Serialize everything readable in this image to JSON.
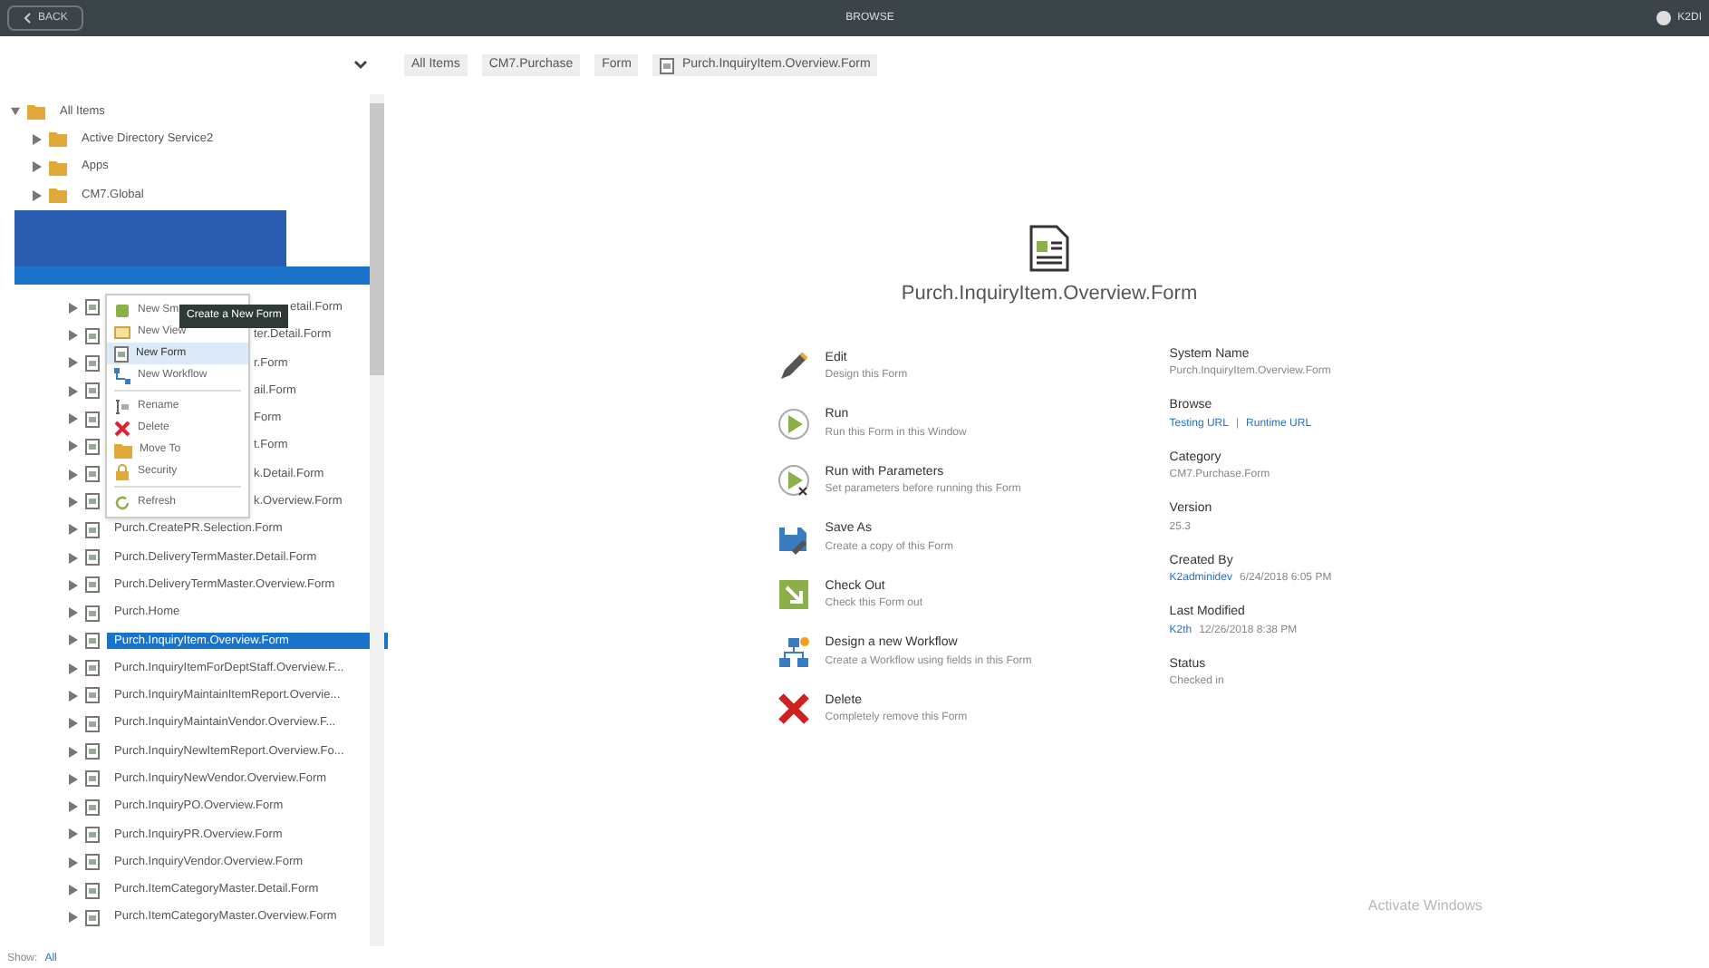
{
  "top_bar": {
    "back": "BACK",
    "title": "BROWSE",
    "user": "K2DI"
  },
  "breadcrumb": [
    "All Items",
    "CM7.Purchase",
    "Form",
    "Purch.InquiryItem.Overview.Form"
  ],
  "tree": {
    "root": {
      "label": "All Items",
      "expanded": true
    },
    "items": [
      {
        "kind": "folder",
        "label": "Active Directory Service2",
        "selected": false
      },
      {
        "kind": "folder",
        "label": "Apps",
        "selected": false
      },
      {
        "kind": "folder",
        "label": "CM7.Global",
        "selected": false
      },
      {
        "kind": "redacted"
      },
      {
        "kind": "partial_tip",
        "label": "etail.Form",
        "selected": false
      },
      {
        "kind": "partial",
        "label": "ter.Detail.Form",
        "selected": false
      },
      {
        "kind": "partial",
        "label": "r.Form",
        "selected": false
      },
      {
        "kind": "partial",
        "label": "ail.Form",
        "selected": false
      },
      {
        "kind": "partial",
        "label": "Form",
        "selected": false
      },
      {
        "kind": "partial",
        "label": "t.Form",
        "selected": false
      },
      {
        "kind": "partial",
        "label": "k.Detail.Form",
        "selected": false
      },
      {
        "kind": "partial",
        "label": "k.Overview.Form",
        "selected": false
      },
      {
        "kind": "form",
        "label": "Purch.CreatePR.Selection.Form",
        "selected": false
      },
      {
        "kind": "form",
        "label": "Purch.DeliveryTermMaster.Detail.Form",
        "selected": false
      },
      {
        "kind": "form",
        "label": "Purch.DeliveryTermMaster.Overview.Form",
        "selected": false
      },
      {
        "kind": "form",
        "label": "Purch.Home",
        "selected": false
      },
      {
        "kind": "form",
        "label": "Purch.InquiryItem.Overview.Form",
        "selected": true
      },
      {
        "kind": "form",
        "label": "Purch.InquiryItemForDeptStaff.Overview.F...",
        "selected": false
      },
      {
        "kind": "form",
        "label": "Purch.InquiryMaintainItemReport.Overvie...",
        "selected": false
      },
      {
        "kind": "form",
        "label": "Purch.InquiryMaintainVendor.Overview.F...",
        "selected": false
      },
      {
        "kind": "form",
        "label": "Purch.InquiryNewItemReport.Overview.Fo...",
        "selected": false
      },
      {
        "kind": "form",
        "label": "Purch.InquiryNewVendor.Overview.Form",
        "selected": false
      },
      {
        "kind": "form",
        "label": "Purch.InquiryPO.Overview.Form",
        "selected": false
      },
      {
        "kind": "form",
        "label": "Purch.InquiryPR.Overview.Form",
        "selected": false
      },
      {
        "kind": "form",
        "label": "Purch.InquiryVendor.Overview.Form",
        "selected": false
      },
      {
        "kind": "form",
        "label": "Purch.ItemCategoryMaster.Detail.Form",
        "selected": false
      },
      {
        "kind": "form",
        "label": "Purch.ItemCategoryMaster.Overview.Form",
        "selected": false
      }
    ]
  },
  "context_menu": [
    {
      "kind": "smartobject",
      "label": "New Sm",
      "selected": false
    },
    {
      "kind": "view",
      "label": "New View",
      "selected": false
    },
    {
      "kind": "form",
      "label": "New Form",
      "selected": true
    },
    {
      "kind": "workflow",
      "label": "New Workflow",
      "selected": false
    },
    {
      "kind": "rename",
      "label": "Rename",
      "selected": false,
      "separator": true
    },
    {
      "kind": "delete",
      "label": "Delete",
      "selected": false
    },
    {
      "kind": "move",
      "label": "Move To",
      "selected": false
    },
    {
      "kind": "security",
      "label": "Security",
      "selected": false
    },
    {
      "kind": "refresh",
      "label": "Refresh",
      "selected": false,
      "separator": true
    }
  ],
  "tooltip": "Create a New Form",
  "footer": {
    "label": "Show:",
    "link": "All"
  },
  "detail": {
    "title": "Purch.InquiryItem.Overview.Form",
    "actions": [
      {
        "kind": "edit",
        "title": "Edit",
        "description": "Design this Form"
      },
      {
        "kind": "run",
        "title": "Run",
        "description": "Run this Form in this Window"
      },
      {
        "kind": "run_params",
        "title": "Run with Parameters",
        "description": "Set parameters before running this Form"
      },
      {
        "kind": "save_as",
        "title": "Save As",
        "description": "Create a copy of this Form"
      },
      {
        "kind": "check_out",
        "title": "Check Out",
        "description": "Check this Form out"
      },
      {
        "kind": "workflow",
        "title": "Design a new Workflow",
        "description": "Create a Workflow using fields in this Form"
      },
      {
        "kind": "delete",
        "title": "Delete",
        "description": "Completely remove this Form"
      }
    ],
    "properties": [
      {
        "label": "System Name",
        "values": [
          {
            "kind": "text",
            "text": "Purch.InquiryItem.Overview.Form"
          }
        ]
      },
      {
        "label": "Browse",
        "values": [
          {
            "kind": "link",
            "text": "Testing URL"
          },
          {
            "kind": "text",
            "text": "|"
          },
          {
            "kind": "link",
            "text": "Runtime URL"
          }
        ]
      },
      {
        "label": "Category",
        "values": [
          {
            "kind": "text",
            "text": "CM7.Purchase.Form"
          }
        ]
      },
      {
        "label": "Version",
        "values": [
          {
            "kind": "text",
            "text": "25.3"
          }
        ]
      },
      {
        "label": "Created By",
        "values": [
          {
            "kind": "link",
            "text": "K2adminidev"
          },
          {
            "kind": "text",
            "text": "6/24/2018 6:05 PM"
          }
        ]
      },
      {
        "label": "Last Modified",
        "values": [
          {
            "kind": "link",
            "text": "K2th"
          },
          {
            "kind": "text",
            "text": "12/26/2018 8:38 PM"
          }
        ]
      },
      {
        "label": "Status",
        "values": [
          {
            "kind": "text",
            "text": "Checked in"
          }
        ]
      }
    ]
  },
  "os_overlay": "Activate Windows"
}
